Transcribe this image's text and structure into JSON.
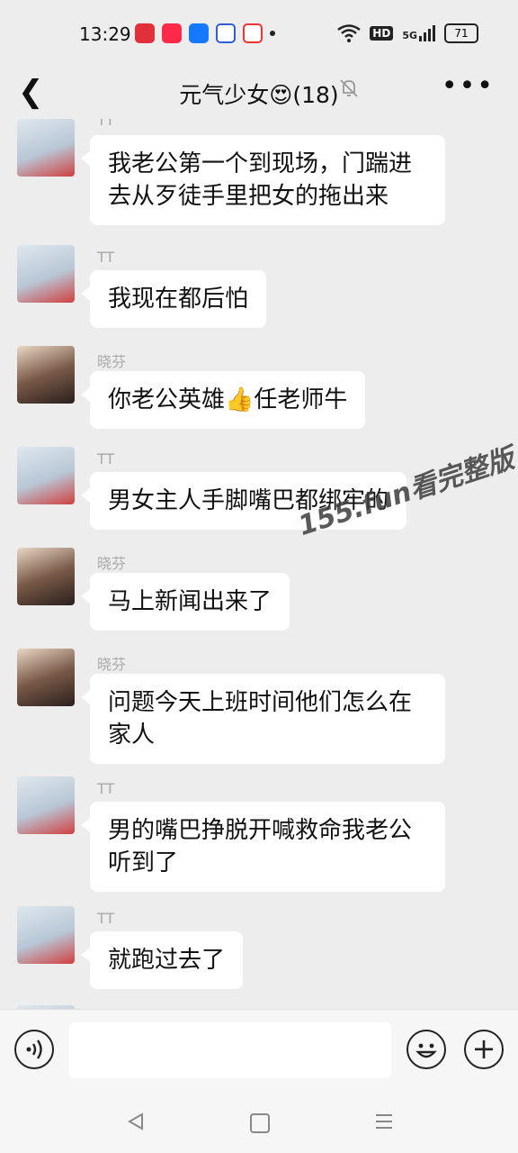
{
  "status": {
    "time": "13:29",
    "hd": "HD",
    "signal": "5G",
    "battery": "71"
  },
  "header": {
    "title": "元气少女😍(18)"
  },
  "messages": [
    {
      "sender": "TT",
      "avatar": "tt-avatar",
      "text": "我老公第一个到现场，门踹进去从歹徒手里把女的拖出来"
    },
    {
      "sender": "TT",
      "avatar": "tt-avatar",
      "text": "我现在都后怕"
    },
    {
      "sender": "晓芬",
      "avatar": "xiaofen-avatar",
      "text": "你老公英雄👍任老师牛"
    },
    {
      "sender": "TT",
      "avatar": "tt-avatar",
      "text": "男女主人手脚嘴巴都绑牢的"
    },
    {
      "sender": "晓芬",
      "avatar": "xiaofen-avatar",
      "text": "马上新闻出来了"
    },
    {
      "sender": "晓芬",
      "avatar": "xiaofen-avatar",
      "text": "问题今天上班时间他们怎么在家人"
    },
    {
      "sender": "TT",
      "avatar": "tt-avatar",
      "text": "男的嘴巴挣脱开喊救命我老公听到了"
    },
    {
      "sender": "TT",
      "avatar": "tt-avatar",
      "text": "就跑过去了"
    }
  ],
  "watermark": "155.fun看完整版",
  "icons": [
    "back-icon",
    "mute-bell-icon",
    "more-icon",
    "voice-icon",
    "emoji-icon",
    "plus-icon"
  ]
}
